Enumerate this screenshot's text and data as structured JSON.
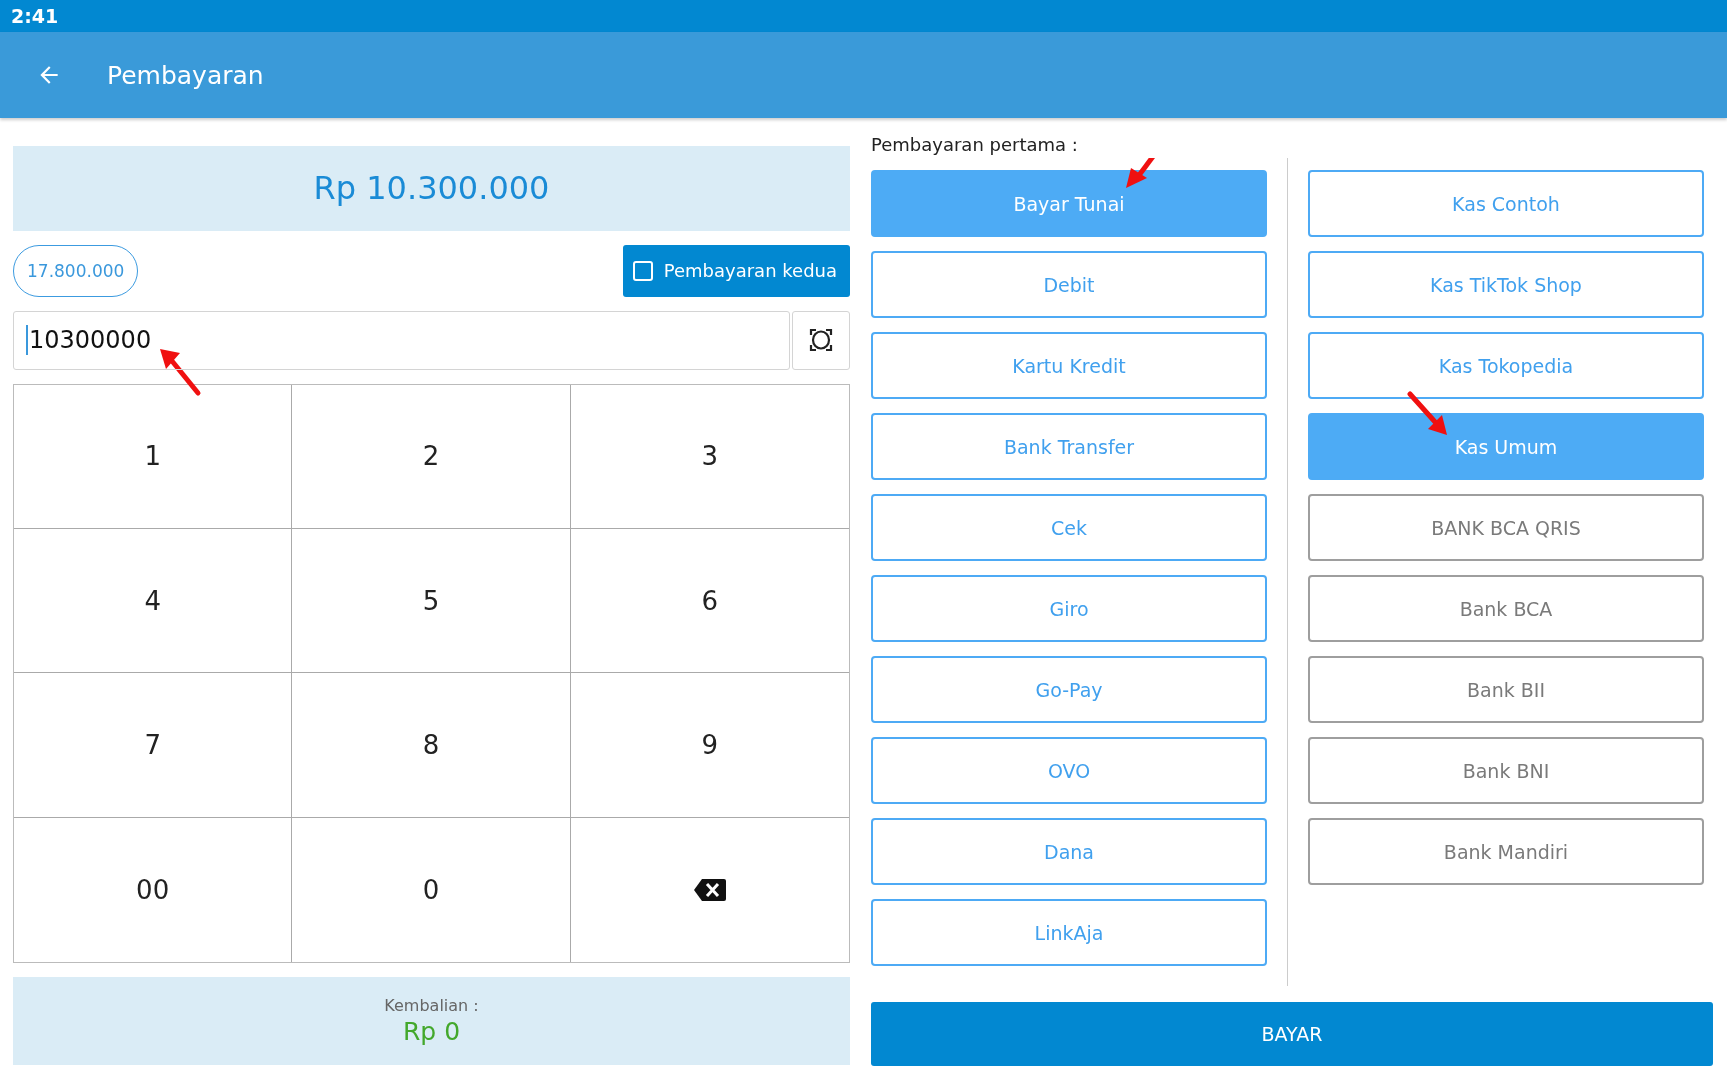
{
  "status_bar": {
    "time": "2:41"
  },
  "app_bar": {
    "title": "Pembayaran"
  },
  "total": {
    "amount": "Rp 10.300.000"
  },
  "suggestion_chip": "17.800.000",
  "second_payment": {
    "label": "Pembayaran kedua",
    "checked": false
  },
  "amount_input": {
    "value": "10300000",
    "annotated": true
  },
  "keypad": [
    {
      "kind": "digit",
      "label": "1"
    },
    {
      "kind": "digit",
      "label": "2"
    },
    {
      "kind": "digit",
      "label": "3"
    },
    {
      "kind": "digit",
      "label": "4"
    },
    {
      "kind": "digit",
      "label": "5"
    },
    {
      "kind": "digit",
      "label": "6"
    },
    {
      "kind": "digit",
      "label": "7"
    },
    {
      "kind": "digit",
      "label": "8"
    },
    {
      "kind": "digit",
      "label": "9"
    },
    {
      "kind": "digit",
      "label": "00"
    },
    {
      "kind": "digit",
      "label": "0"
    },
    {
      "kind": "backspace"
    }
  ],
  "change": {
    "label": "Kembalian :",
    "amount": "Rp 0"
  },
  "first_payment": {
    "label": "Pembayaran pertama :",
    "methods": [
      {
        "label": "Bayar Tunai",
        "selected": true,
        "annotated": true
      },
      {
        "label": "Debit",
        "selected": false,
        "annotated": false
      },
      {
        "label": "Kartu Kredit",
        "selected": false,
        "annotated": false
      },
      {
        "label": "Bank Transfer",
        "selected": false,
        "annotated": false
      },
      {
        "label": "Cek",
        "selected": false,
        "annotated": false
      },
      {
        "label": "Giro",
        "selected": false,
        "annotated": false
      },
      {
        "label": "Go-Pay",
        "selected": false,
        "annotated": false
      },
      {
        "label": "OVO",
        "selected": false,
        "annotated": false
      },
      {
        "label": "Dana",
        "selected": false,
        "annotated": false
      },
      {
        "label": "LinkAja",
        "selected": false,
        "annotated": false
      }
    ]
  },
  "accounts": [
    {
      "label": "Kas Contoh",
      "kind": "cash",
      "selected": false,
      "annotated": false
    },
    {
      "label": "Kas TikTok Shop",
      "kind": "cash",
      "selected": false,
      "annotated": false
    },
    {
      "label": "Kas Tokopedia",
      "kind": "cash",
      "selected": false,
      "annotated": false
    },
    {
      "label": "Kas Umum",
      "kind": "cash",
      "selected": true,
      "annotated": true
    },
    {
      "label": "BANK BCA QRIS",
      "kind": "bank",
      "selected": false,
      "annotated": false
    },
    {
      "label": "Bank BCA",
      "kind": "bank",
      "selected": false,
      "annotated": false
    },
    {
      "label": "Bank BII",
      "kind": "bank",
      "selected": false,
      "annotated": false
    },
    {
      "label": "Bank BNI",
      "kind": "bank",
      "selected": false,
      "annotated": false
    },
    {
      "label": "Bank Mandiri",
      "kind": "bank",
      "selected": false,
      "annotated": false
    }
  ],
  "pay_button": "BAYAR"
}
